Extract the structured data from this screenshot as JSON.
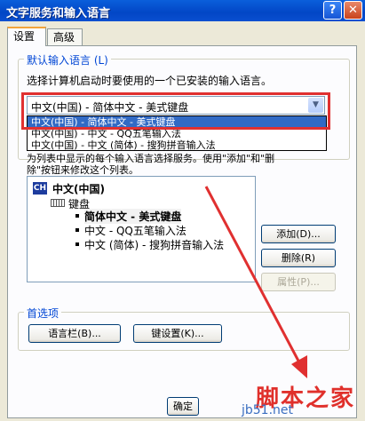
{
  "window": {
    "title": "文字服务和输入语言",
    "help_label": "?",
    "close_label": "✕"
  },
  "tabs": [
    {
      "label": "设置",
      "active": true
    },
    {
      "label": "高级",
      "active": false
    }
  ],
  "default_lang": {
    "group_label": "默认输入语言 (L)",
    "description": "选择计算机启动时要使用的一个已安装的输入语言。",
    "selected_value": "中文(中国) - 简体中文 - 美式键盘",
    "options": [
      {
        "label": "中文(中国) - 简体中文 - 美式键盘",
        "selected": true
      },
      {
        "label": "中文(中国) - 中文 - QQ五笔输入法",
        "selected": false
      },
      {
        "label": "中文(中国) - 中文 (简体) - 搜狗拼音输入法",
        "selected": false
      }
    ]
  },
  "installed": {
    "description_partial": "为列表中显示的每个输入语言选择服务。使用\"添加\"和\"删",
    "description_line2": "除\"按钮来修改这个列表。",
    "tree": {
      "language": "中文(中国)",
      "lang_badge": "CH",
      "keyboard": "键盘",
      "services": [
        "简体中文 - 美式键盘",
        "中文 - QQ五笔输入法",
        "中文 (简体) - 搜狗拼音输入法"
      ]
    },
    "buttons": {
      "add": "添加(D)...",
      "remove": "删除(R)",
      "properties": "属性(P)..."
    }
  },
  "preferences": {
    "group_label": "首选项",
    "language_bar": "语言栏(B)...",
    "key_settings": "键设置(K)..."
  },
  "footer": {
    "ok": "确定"
  },
  "watermark": {
    "site": "脚本之家",
    "url": "jb51.net"
  },
  "colors": {
    "title_bar": "#0A5FDB",
    "selection": "#316AC5",
    "highlight_box": "#E03030",
    "arrow": "#E03030"
  }
}
